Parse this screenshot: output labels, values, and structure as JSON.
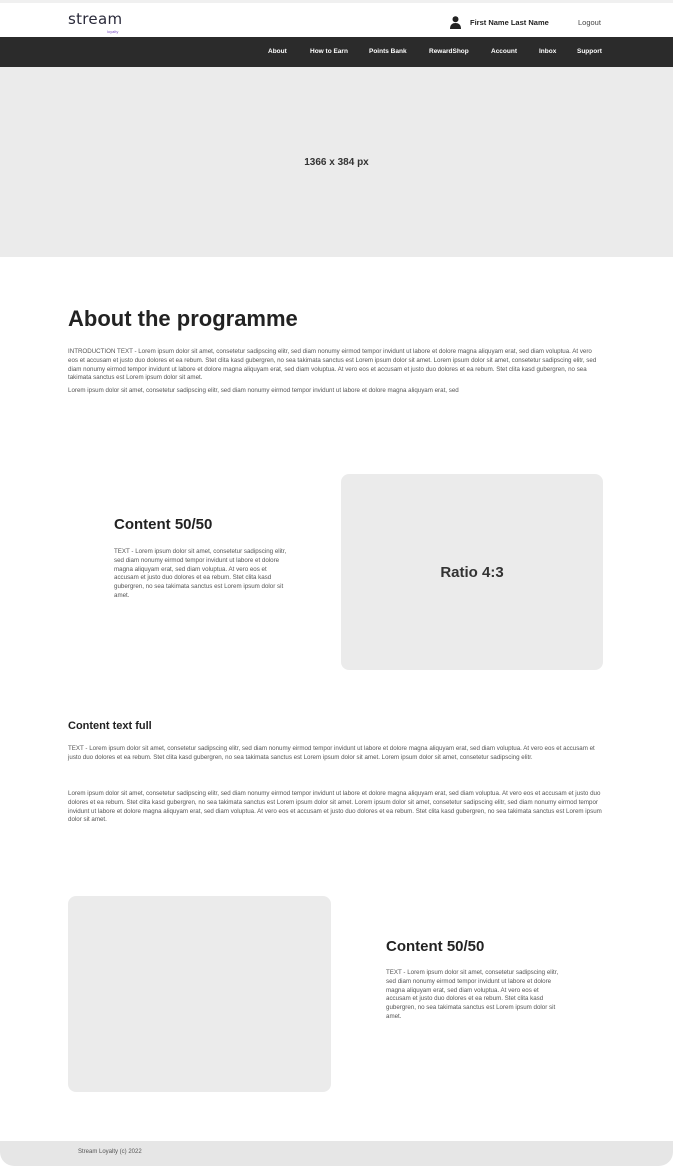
{
  "header": {
    "logo_text": "stream",
    "logo_sub": "loyalty",
    "user_icon": "user-icon",
    "user_name": "First Name Last Name",
    "logout_label": "Logout"
  },
  "nav": {
    "items": [
      "About",
      "How to Earn",
      "Points Bank",
      "RewardShop",
      "Account",
      "Inbox",
      "Support"
    ]
  },
  "hero": {
    "label": "1366 x 384 px"
  },
  "about": {
    "title": "About the programme",
    "intro": "INTRODUCTION TEXT - Lorem ipsum dolor sit amet, consetetur sadipscing elitr, sed diam nonumy eirmod tempor invidunt ut labore et dolore magna aliquyam erat, sed diam voluptua. At vero eos et accusam et justo duo dolores et ea rebum. Stet clita kasd gubergren, no sea takimata sanctus est Lorem ipsum dolor sit amet. Lorem ipsum dolor sit amet, consetetur sadipscing elitr, sed diam nonumy eirmod tempor invidunt ut labore et dolore magna aliquyam erat, sed diam voluptua. At vero eos et accusam et justo duo dolores et ea rebum. Stet clita kasd gubergren, no sea takimata sanctus est Lorem ipsum dolor sit amet.",
    "text2": "Lorem ipsum dolor sit amet, consetetur sadipscing elitr, sed diam nonumy eirmod tempor invidunt ut labore et dolore magna aliquyam erat, sed"
  },
  "content1": {
    "title": "Content 50/50",
    "text": "TEXT - Lorem ipsum dolor sit amet, consetetur sadipscing elitr, sed diam nonumy eirmod tempor invidunt ut labore et dolore magna aliquyam erat, sed diam voluptua. At vero eos et accusam et justo duo dolores et ea rebum. Stet clita kasd gubergren, no sea takimata sanctus est Lorem ipsum dolor sit amet.",
    "image_label": "Ratio 4:3"
  },
  "content_full": {
    "title": "Content text full",
    "para1": "TEXT - Lorem ipsum dolor sit amet, consetetur sadipscing elitr, sed diam nonumy eirmod tempor invidunt ut labore et dolore magna aliquyam erat, sed diam voluptua. At vero eos et accusam et justo duo dolores et ea rebum. Stet clita kasd gubergren, no sea takimata sanctus est Lorem ipsum dolor sit amet. Lorem ipsum dolor sit amet, consetetur sadipscing elitr.",
    "para2": "Lorem ipsum dolor sit amet, consetetur sadipscing elitr, sed diam nonumy eirmod tempor invidunt ut labore et dolore magna aliquyam erat, sed diam voluptua. At vero eos et accusam et justo duo dolores et ea rebum. Stet clita kasd gubergren, no sea takimata sanctus est Lorem ipsum dolor sit amet. Lorem ipsum dolor sit amet, consetetur sadipscing elitr, sed diam nonumy eirmod tempor invidunt ut labore et dolore magna aliquyam erat, sed diam voluptua. At vero eos et accusam et justo duo dolores et ea rebum. Stet clita kasd gubergren, no sea takimata sanctus est Lorem ipsum dolor sit amet."
  },
  "content2": {
    "title": "Content 50/50",
    "text": "TEXT - Lorem ipsum dolor sit amet, consetetur sadipscing elitr, sed diam nonumy eirmod tempor invidunt ut labore et dolore magna aliquyam erat, sed diam voluptua. At vero eos et accusam et justo duo dolores et ea rebum. Stet clita kasd gubergren, no sea takimata sanctus est Lorem ipsum dolor sit amet."
  },
  "footer": {
    "text": "Stream Loyalty (c) 2022"
  }
}
